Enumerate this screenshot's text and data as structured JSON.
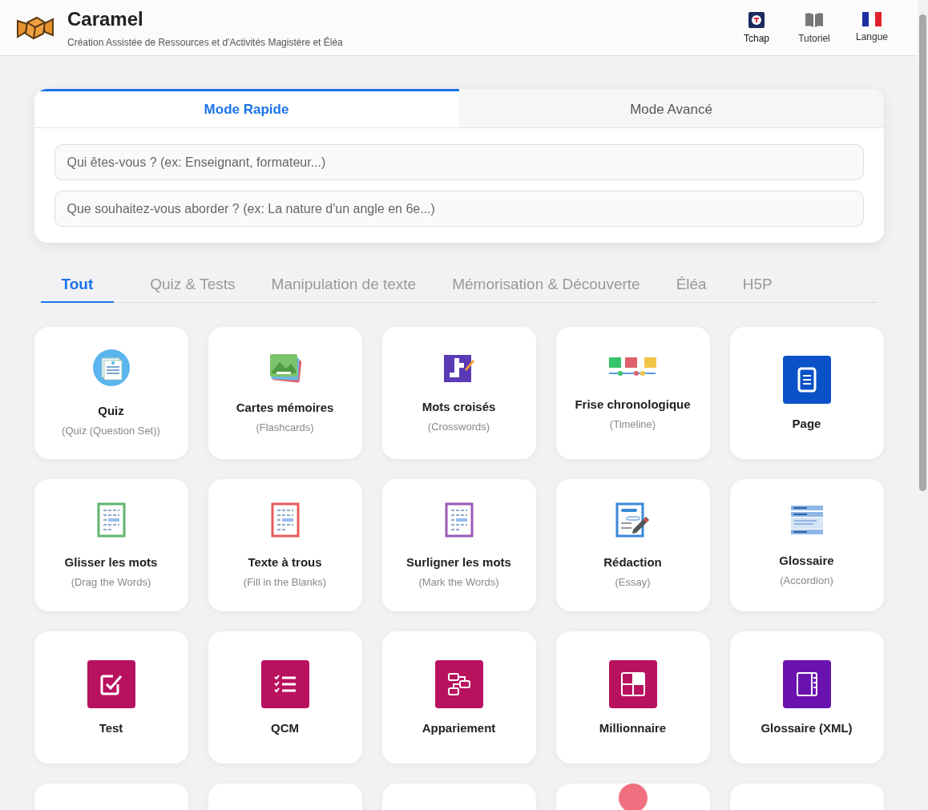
{
  "header": {
    "title": "Caramel",
    "subtitle": "Création Assistée de Ressources et d'Activités Magistère et Éléa",
    "actions": [
      {
        "label": "Tchap",
        "kind": "tchap"
      },
      {
        "label": "Tutoriel",
        "kind": "book"
      },
      {
        "label": "Langue",
        "kind": "flag"
      }
    ]
  },
  "modes": [
    {
      "label": "Mode Rapide",
      "selected": true
    },
    {
      "label": "Mode Avancé",
      "selected": false
    }
  ],
  "fields": [
    {
      "placeholder": "Qui êtes-vous ? (ex: Enseignant, formateur...)"
    },
    {
      "placeholder": "Que souhaitez-vous aborder ? (ex: La nature d'un angle en 6e...)"
    }
  ],
  "categories": [
    {
      "label": "Tout",
      "selected": true
    },
    {
      "label": "Quiz & Tests",
      "selected": false
    },
    {
      "label": "Manipulation de texte",
      "selected": false
    },
    {
      "label": "Mémorisation & Découverte",
      "selected": false
    },
    {
      "label": "Éléa",
      "selected": false
    },
    {
      "label": "H5P",
      "selected": false
    }
  ],
  "cards": [
    {
      "kind": "quiz",
      "title": "Quiz",
      "subtitle": "(Quiz (Question Set))"
    },
    {
      "kind": "flashcards",
      "title": "Cartes mémoires",
      "subtitle": "(Flashcards)"
    },
    {
      "kind": "crossword",
      "title": "Mots croisés",
      "subtitle": "(Crosswords)"
    },
    {
      "kind": "timeline",
      "title": "Frise chronologique",
      "subtitle": "(Timeline)"
    },
    {
      "kind": "page",
      "title": "Page"
    },
    {
      "kind": "drag",
      "title": "Glisser les mots",
      "subtitle": "(Drag the Words)"
    },
    {
      "kind": "fill",
      "title": "Texte à trous",
      "subtitle": "(Fill in the Blanks)"
    },
    {
      "kind": "mark",
      "title": "Surligner les mots",
      "subtitle": "(Mark the Words)"
    },
    {
      "kind": "essay",
      "title": "Rédaction",
      "subtitle": "(Essay)"
    },
    {
      "kind": "accordion",
      "title": "Glossaire",
      "subtitle": "(Accordion)"
    },
    {
      "kind": "test",
      "title": "Test"
    },
    {
      "kind": "qcm",
      "title": "QCM"
    },
    {
      "kind": "match",
      "title": "Appariement"
    },
    {
      "kind": "millionaire",
      "title": "Millionnaire"
    },
    {
      "kind": "glossary",
      "title": "Glossaire (XML)"
    },
    {
      "kind": "blank"
    },
    {
      "kind": "blank"
    },
    {
      "kind": "blank"
    },
    {
      "kind": "circle"
    },
    {
      "kind": "blank"
    }
  ]
}
